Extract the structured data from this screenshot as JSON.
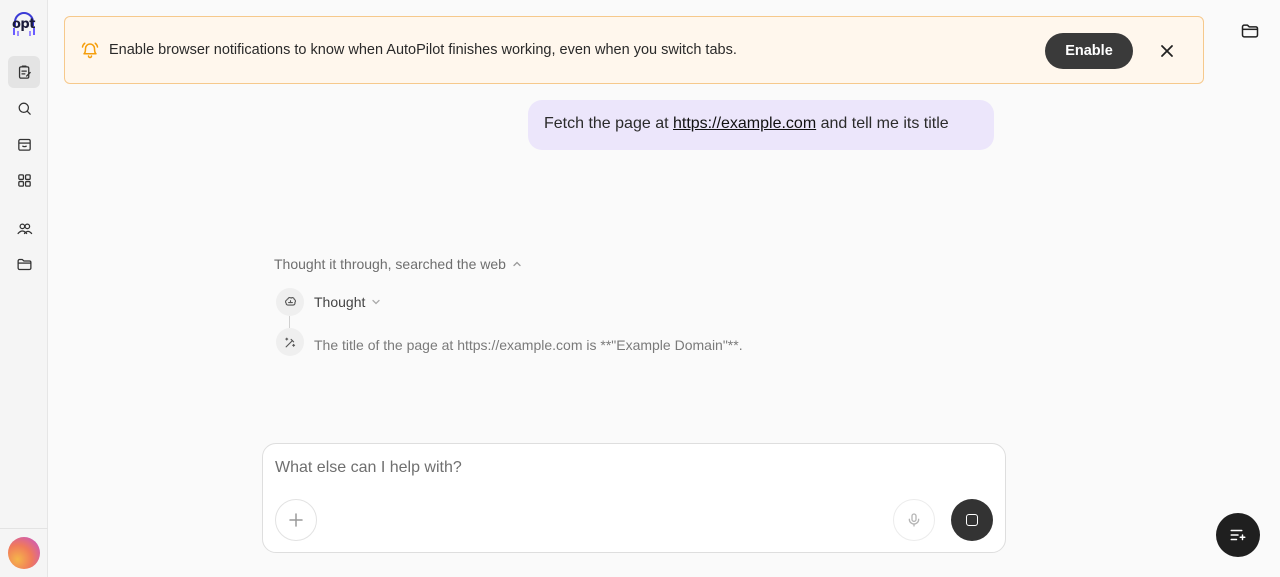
{
  "sidebar": {
    "logo_text": "opt",
    "items": [
      {
        "name": "tasks",
        "icon": "clipboard-icon",
        "active": true
      },
      {
        "name": "search",
        "icon": "search-icon",
        "active": false
      },
      {
        "name": "store",
        "icon": "store-icon",
        "active": false
      },
      {
        "name": "apps",
        "icon": "grid-icon",
        "active": false
      },
      {
        "name": "teams",
        "icon": "users-icon",
        "active": false
      },
      {
        "name": "files",
        "icon": "folder-icon",
        "active": false
      }
    ]
  },
  "banner": {
    "text": "Enable browser notifications to know when AutoPilot finishes working, even when you switch tabs.",
    "enable_label": "Enable",
    "accent": "#f59e0b"
  },
  "conversation": {
    "user_message": {
      "prefix": "Fetch the page at ",
      "link": "https://example.com",
      "suffix": " and tell me its title"
    },
    "thought_summary": "Thought it through, searched the web",
    "thought_label": "Thought",
    "result": "The title of the page at https://example.com is **\"Example Domain\"**."
  },
  "composer": {
    "placeholder": "What else can I help with?"
  },
  "colors": {
    "user_bubble": "#ece6fb",
    "banner_bg": "#fff7ed",
    "dark_button": "#3a3a3a"
  }
}
